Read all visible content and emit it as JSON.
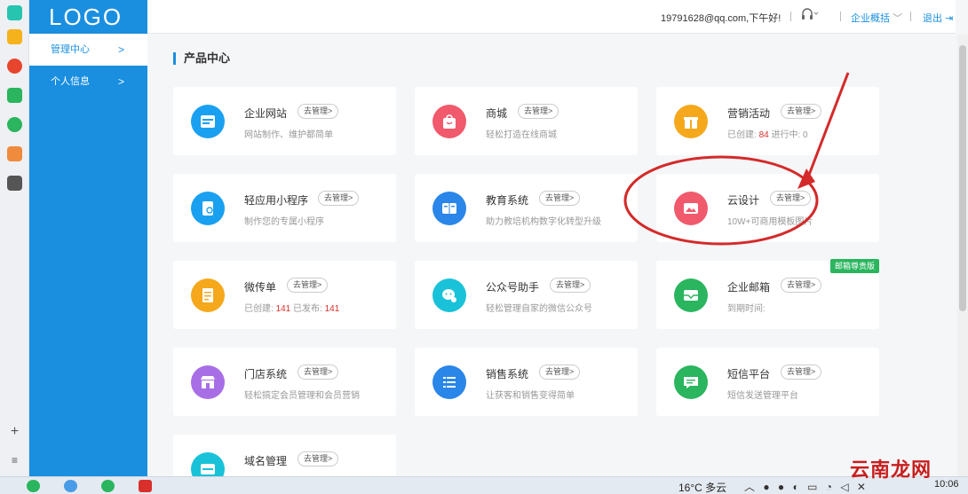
{
  "sidebar": {
    "logo": "LOGO",
    "items": [
      {
        "label": "管理中心",
        "chevron": ">",
        "active": true
      },
      {
        "label": "个人信息",
        "chevron": ">",
        "active": false
      }
    ]
  },
  "header": {
    "user": "19791628@qq.com,下午好!",
    "service_icon": "headset-icon",
    "overview": "企业概括",
    "logout": "退出"
  },
  "main": {
    "section_title": "产品中心",
    "cards": [
      {
        "name": "企业网站",
        "manage": "去管理>",
        "desc": "网站制作、维护都简单",
        "icon": "website-icon",
        "color": "#1aa0f0"
      },
      {
        "name": "商城",
        "manage": "去管理>",
        "desc": "轻松打造在线商城",
        "icon": "shop-bag-icon",
        "color": "#f05a6c"
      },
      {
        "name": "营销活动",
        "manage": "去管理>",
        "desc_prefix": "已创建: ",
        "created": "84",
        "desc_mid": " 进行中: 0",
        "icon": "gift-icon",
        "color": "#f5a81c"
      },
      {
        "name": "轻应用小程序",
        "manage": "去管理>",
        "desc": "制作您的专属小程序",
        "icon": "miniapp-icon",
        "color": "#1aa0f0"
      },
      {
        "name": "教育系统",
        "manage": "去管理>",
        "desc": "助力教培机构数字化转型升级",
        "icon": "book-icon",
        "color": "#2a86e8"
      },
      {
        "name": "云设计",
        "manage": "去管理>",
        "desc": "10W+可商用模板图片",
        "icon": "image-icon",
        "color": "#f05a6c"
      },
      {
        "name": "微传单",
        "manage": "去管理>",
        "desc_prefix": "已创建: ",
        "created": "141",
        "desc_mid": "  已发布: ",
        "published": "141",
        "icon": "flyer-icon",
        "color": "#f5a81c"
      },
      {
        "name": "公众号助手",
        "manage": "去管理>",
        "desc": "轻松管理自家的微信公众号",
        "icon": "wechat-icon",
        "color": "#19c2d8"
      },
      {
        "name": "企业邮箱",
        "manage": "去管理>",
        "desc": "到期时间:",
        "badge": "邮箱尊贵版",
        "icon": "mail-icon",
        "color": "#2ab55e"
      },
      {
        "name": "门店系统",
        "manage": "去管理>",
        "desc": "轻松搞定会员管理和会员营销",
        "icon": "store-icon",
        "color": "#a86ee6"
      },
      {
        "name": "销售系统",
        "manage": "去管理>",
        "desc": "让获客和销售变得简单",
        "icon": "list-icon",
        "color": "#2a86e8"
      },
      {
        "name": "短信平台",
        "manage": "去管理>",
        "desc": "短信发送管理平台",
        "icon": "sms-icon",
        "color": "#2ab55e"
      },
      {
        "name": "域名管理",
        "manage": "去管理>",
        "desc": "",
        "icon": "domain-icon",
        "color": "#19c2d8"
      }
    ]
  },
  "taskbar": {
    "weather": "16°C 多云",
    "clock": "10:06"
  },
  "watermark": "云南龙网",
  "colors": {
    "accent": "#1a8fe0",
    "annotation": "#d42a2a"
  }
}
